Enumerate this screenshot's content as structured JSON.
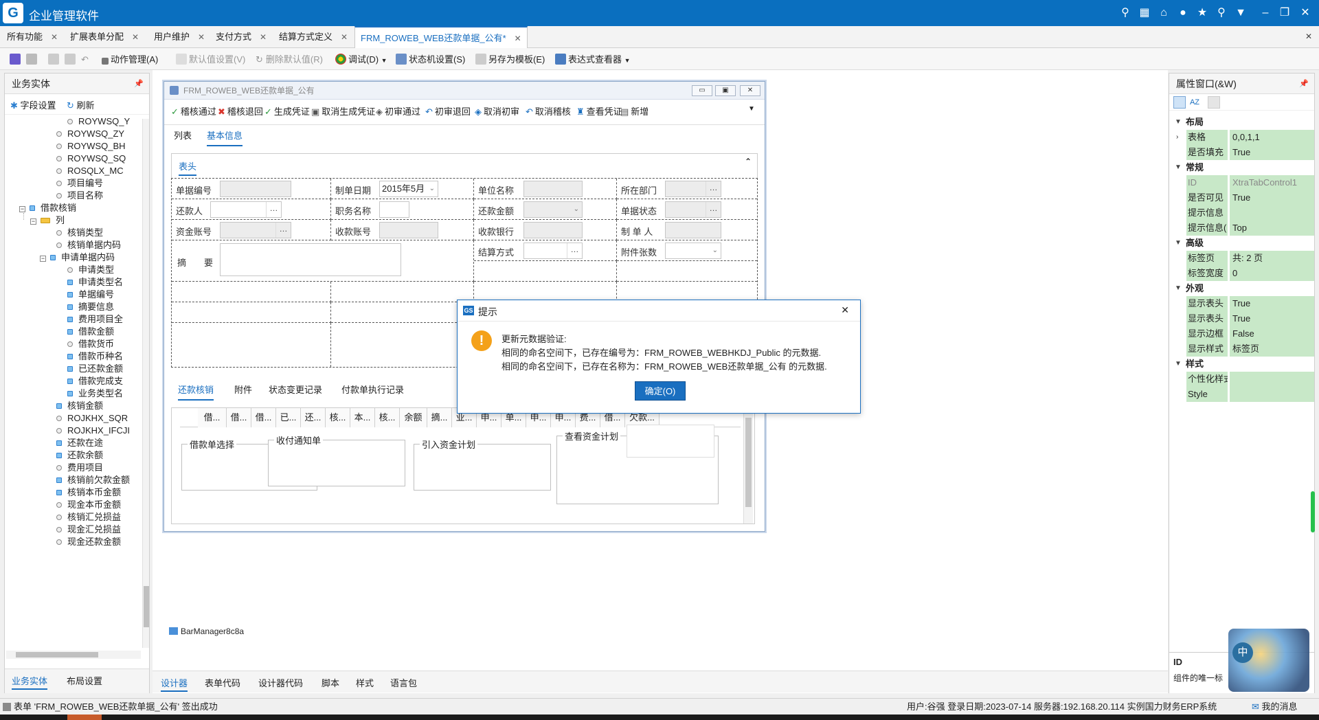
{
  "app": {
    "title": "企业管理软件"
  },
  "tabs": [
    {
      "label": "所有功能"
    },
    {
      "label": "扩展表单分配"
    },
    {
      "label": "用户维护"
    },
    {
      "label": "支付方式"
    },
    {
      "label": "结算方式定义"
    },
    {
      "label": "FRM_ROWEB_WEB还款单据_公有*"
    }
  ],
  "toolbar": {
    "action_mgmt": "动作管理(A)",
    "default_set": "默认值设置(V)",
    "delete_default": "删除默认值(R)",
    "debug": "调试(D)",
    "state_machine": "状态机设置(S)",
    "save_template": "另存为模板(E)",
    "table_viewer": "表达式查看器"
  },
  "left_panel": {
    "title": "业务实体",
    "field_settings": "字段设置",
    "refresh": "刷新",
    "tree": [
      {
        "label": "ROYWSQ_Y",
        "kind": "dot"
      },
      {
        "label": "ROYWSQ_ZY",
        "kind": "dot"
      },
      {
        "label": "ROYWSQ_BH",
        "kind": "dot"
      },
      {
        "label": "ROYWSQ_SQ",
        "kind": "dot"
      },
      {
        "label": "ROSQLX_MC",
        "kind": "dot"
      },
      {
        "label": "项目编号",
        "kind": "dot"
      },
      {
        "label": "项目名称",
        "kind": "dot"
      },
      {
        "label": "借款核销",
        "kind": "table"
      },
      {
        "label": "列",
        "kind": "folder"
      },
      {
        "label": "核销类型",
        "kind": "dot"
      },
      {
        "label": "核销单据内码",
        "kind": "dot"
      },
      {
        "label": "申请单据内码",
        "kind": "expand"
      },
      {
        "label": "申请类型",
        "kind": "dot"
      },
      {
        "label": "申请类型名",
        "kind": "blue"
      },
      {
        "label": "单据编号",
        "kind": "blue"
      },
      {
        "label": "摘要信息",
        "kind": "blue"
      },
      {
        "label": "费用项目全",
        "kind": "blue"
      },
      {
        "label": "借款金额",
        "kind": "blue"
      },
      {
        "label": "借款货币",
        "kind": "dot"
      },
      {
        "label": "借款币种名",
        "kind": "blue"
      },
      {
        "label": "已还款金额",
        "kind": "blue"
      },
      {
        "label": "借款完成支",
        "kind": "blue"
      },
      {
        "label": "业务类型名",
        "kind": "blue"
      },
      {
        "label": "核销金额",
        "kind": "blue"
      },
      {
        "label": "ROJKHX_SQR",
        "kind": "dot"
      },
      {
        "label": "ROJKHX_IFCJI",
        "kind": "dot"
      },
      {
        "label": "还款在途",
        "kind": "blue"
      },
      {
        "label": "还款余额",
        "kind": "blue"
      },
      {
        "label": "费用项目",
        "kind": "dot"
      },
      {
        "label": "核销前欠款金额",
        "kind": "blue"
      },
      {
        "label": "核销本币金额",
        "kind": "blue"
      },
      {
        "label": "现金本币金额",
        "kind": "dot"
      },
      {
        "label": "核销汇兑损益",
        "kind": "dot"
      },
      {
        "label": "现金汇兑损益",
        "kind": "dot"
      },
      {
        "label": "现金还款金额",
        "kind": "dot"
      }
    ],
    "bottom_tabs": [
      "业务实体",
      "布局设置"
    ]
  },
  "form": {
    "title": "FRM_ROWEB_WEB还款单据_公有",
    "toolbar": [
      "稽核通过",
      "稽核退回",
      "生成凭证",
      "取消生成凭证",
      "初审通过",
      "初审退回",
      "取消初审",
      "取消稽核",
      "查看凭证",
      "新增"
    ],
    "tabs": [
      "列表",
      "基本信息"
    ],
    "section": "表头",
    "fields": {
      "doc_no": "单据编号",
      "date": "制单日期",
      "date_value": "2015年5月",
      "unit": "单位名称",
      "dept": "所在部门",
      "repayer": "还款人",
      "position": "职务名称",
      "amount": "还款金额",
      "status": "单据状态",
      "fund_acct": "资金账号",
      "recv_acct": "收款账号",
      "recv_bank": "收款银行",
      "maker": "制 单 人",
      "settle": "结算方式",
      "attach": "附件张数",
      "summary": "摘　　要"
    },
    "sub_tabs": [
      "还款核销",
      "附件",
      "状态变更记录",
      "付款单执行记录"
    ],
    "grid_headers": [
      "借...",
      "借...",
      "借...",
      "已...",
      "还...",
      "核...",
      "本...",
      "核...",
      "余额",
      "摘...",
      "业...",
      "申...",
      "单...",
      "申...",
      "申...",
      "费...",
      "借...",
      "欠款..."
    ],
    "groups": [
      "借款单选择",
      "收付通知单",
      "引入资金计划",
      "查看资金计划"
    ]
  },
  "dialog": {
    "title": "提示",
    "heading": "更新元数据验证:",
    "line1": "相同的命名空间下，已存在编号为：FRM_ROWEB_WEBHKDJ_Public 的元数据.",
    "line2": "相同的命名空间下，已存在名称为：FRM_ROWEB_WEB还款单据_公有 的元数据.",
    "ok": "确定(O)"
  },
  "bar_manager": "BarManager8c8a",
  "right_panel": {
    "title": "属性窗口(&W)",
    "rows": [
      {
        "type": "sec",
        "k": "布局"
      },
      {
        "type": "prop",
        "k": "表格",
        "v": "0,0,1,1",
        "expand": true
      },
      {
        "type": "prop",
        "k": "是否填充",
        "v": "True"
      },
      {
        "type": "sec",
        "k": "常规"
      },
      {
        "type": "prop",
        "k": "ID",
        "v": "XtraTabControl1",
        "dim": true
      },
      {
        "type": "prop",
        "k": "是否可见",
        "v": "True"
      },
      {
        "type": "prop",
        "k": "提示信息",
        "v": ""
      },
      {
        "type": "prop",
        "k": "提示信息(",
        "v": "Top"
      },
      {
        "type": "sec",
        "k": "高级"
      },
      {
        "type": "prop",
        "k": "标签页",
        "v": "共: 2 页"
      },
      {
        "type": "prop",
        "k": "标签宽度",
        "v": "0"
      },
      {
        "type": "sec",
        "k": "外观"
      },
      {
        "type": "prop",
        "k": "显示表头",
        "v": "True"
      },
      {
        "type": "prop",
        "k": "显示表头",
        "v": "True"
      },
      {
        "type": "prop",
        "k": "显示边框",
        "v": "False"
      },
      {
        "type": "prop",
        "k": "显示样式",
        "v": "标签页"
      },
      {
        "type": "sec",
        "k": "样式"
      },
      {
        "type": "prop",
        "k": "个性化样式",
        "v": ""
      },
      {
        "type": "prop",
        "k": "Style",
        "v": ""
      }
    ],
    "desc_title": "ID",
    "desc_text": "组件的唯一标"
  },
  "bottom_tabs": [
    "设计器",
    "表单代码",
    "设计器代码",
    "脚本",
    "样式",
    "语言包"
  ],
  "status": {
    "left": "表单 'FRM_ROWEB_WEB还款单据_公有' 签出成功",
    "right": "用户:谷强 登录日期:2023-07-14  服务器:192.168.20.114 实例国力财务ERP系统",
    "messages": "我的消息"
  },
  "colors": {
    "accent": "#1a6fc0",
    "titlebar": "#0a6fbf",
    "prop_bg": "#c8e8c8"
  }
}
